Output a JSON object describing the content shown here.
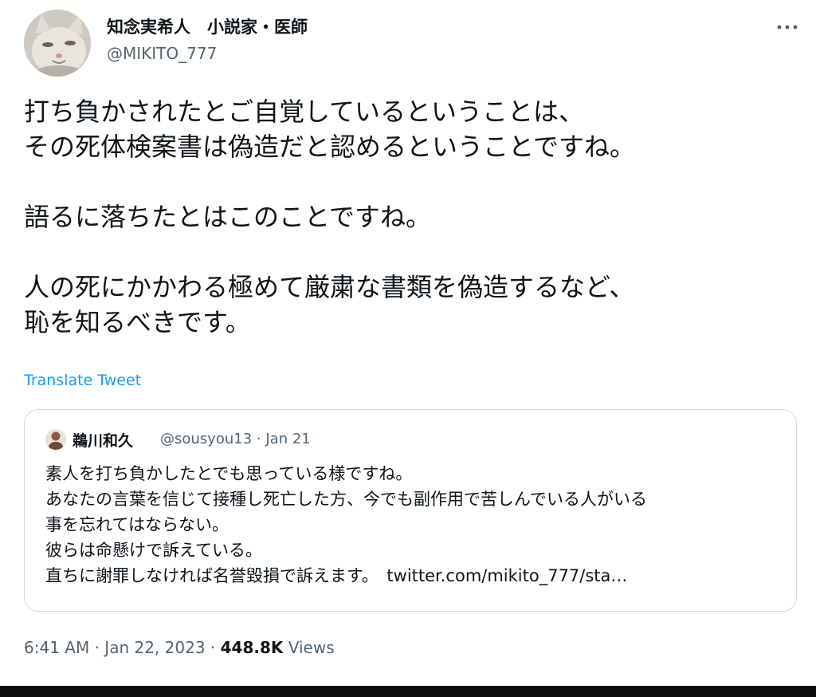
{
  "tweet": {
    "author": {
      "display_name": "知念実希人　小説家・医師",
      "handle": "@MIKITO_777"
    },
    "body_paragraphs": [
      [
        "打ち負かされたとご自覚しているということは、",
        "その死体検案書は偽造だと認めるということですね。"
      ],
      [
        "語るに落ちたとはこのことですね。"
      ],
      [
        "人の死にかかわる極めて厳粛な書類を偽造するなど、",
        "恥を知るべきです。"
      ]
    ],
    "translate_label": "Translate Tweet",
    "quoted": {
      "display_name": "鵜川和久",
      "handle": "@sousyou13",
      "separator": "·",
      "date": "Jan 21",
      "lines": [
        "素人を打ち負かしたとでも思っている様ですね。",
        "あなたの言葉を信じて接種し死亡した方、今でも副作用で苦しんでいる人がいる",
        "事を忘れてはならない。",
        "彼らは命懸けで訴えている。",
        "直ちに謝罪しなければ名誉毀損で訴えます。"
      ],
      "link": "twitter.com/mikito_777/sta…"
    },
    "meta": {
      "time": "6:41 AM",
      "sep1": "·",
      "date": "Jan 22, 2023",
      "sep2": "·",
      "views_count": "448.8K",
      "views_label": "Views"
    },
    "icons": {
      "more": "more-horizontal-icon",
      "avatar": "cat-avatar",
      "quoted_avatar": "person-avatar"
    },
    "colors": {
      "text": "#0f1419",
      "secondary": "#536471",
      "link": "#1d9bf0",
      "border": "#cfd9de"
    }
  }
}
